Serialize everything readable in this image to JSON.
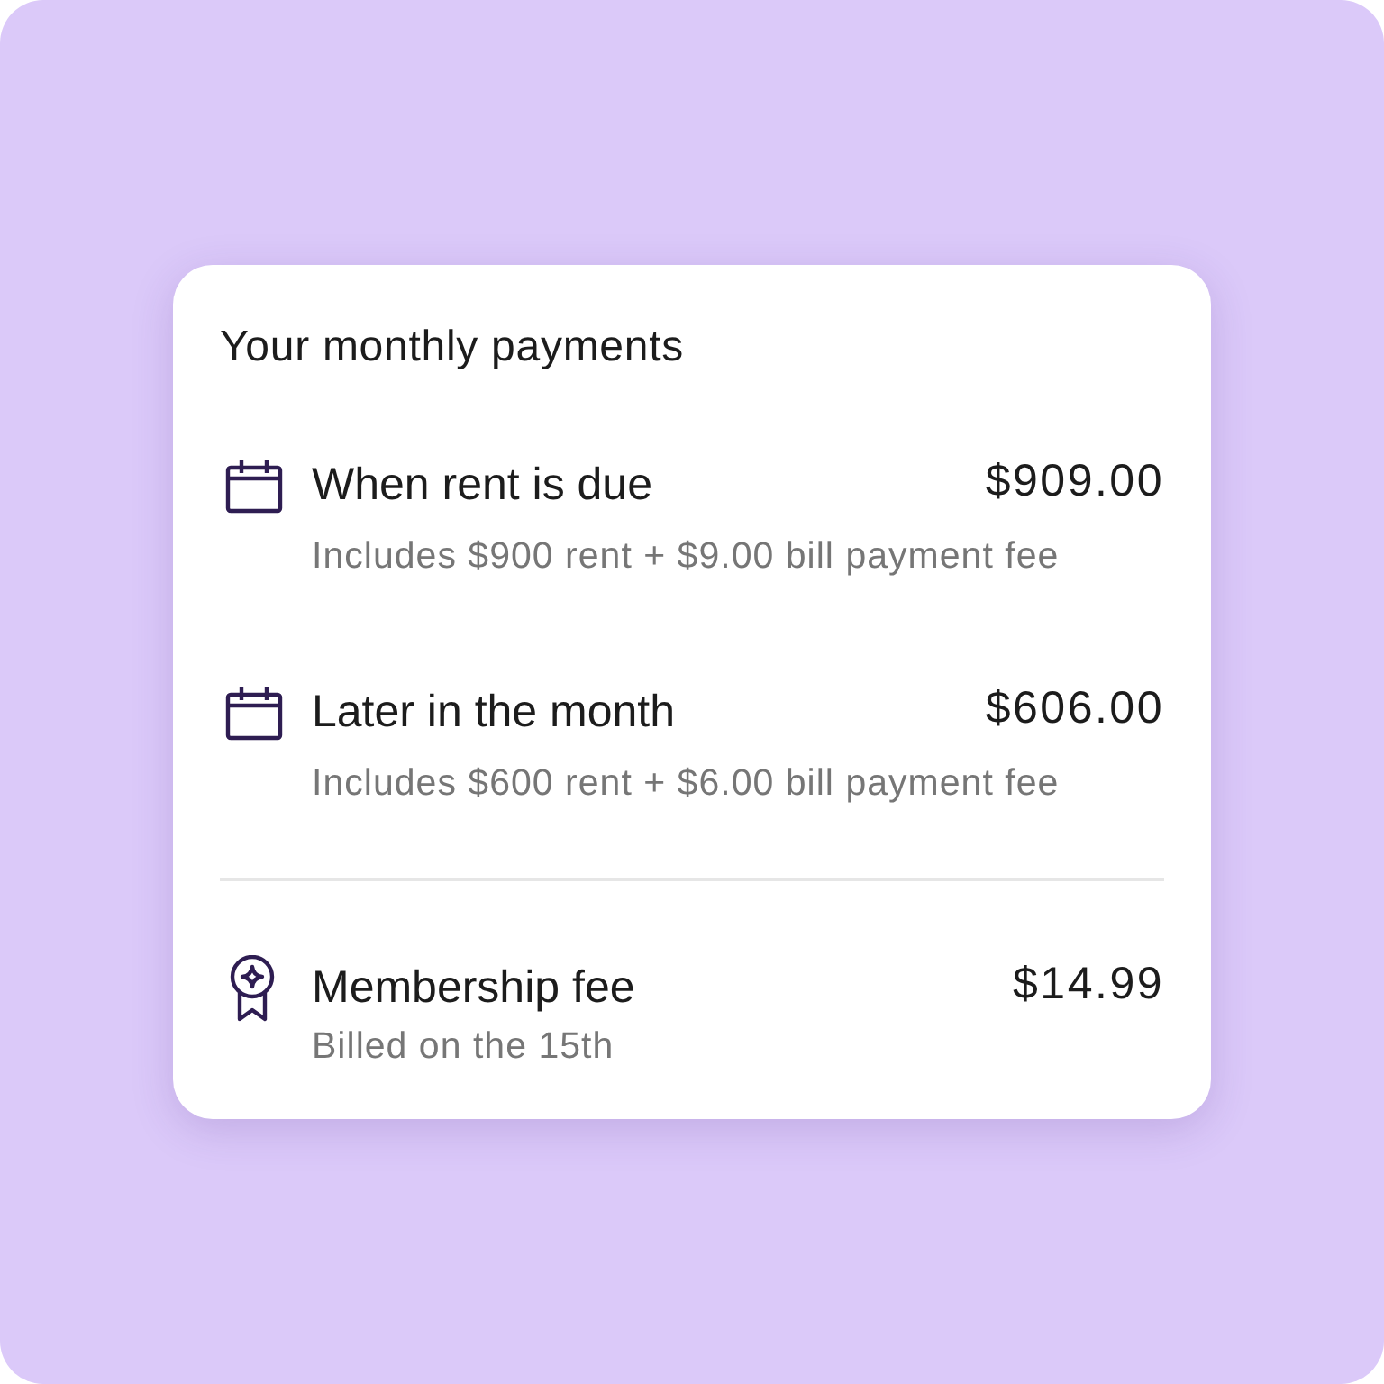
{
  "card": {
    "title": "Your monthly payments",
    "sections": [
      {
        "items": [
          {
            "kind": "calendar",
            "title": "When rent is due",
            "amount": "$909.00",
            "detail": "Includes $900 rent + $9.00 bill payment fee"
          },
          {
            "kind": "calendar",
            "title": "Later in the month",
            "amount": "$606.00",
            "detail": "Includes $600 rent + $6.00 bill payment fee"
          }
        ]
      },
      {
        "items": [
          {
            "kind": "award",
            "title": "Membership fee",
            "amount": "$14.99",
            "detail": "Billed on the 15th"
          }
        ]
      }
    ]
  }
}
